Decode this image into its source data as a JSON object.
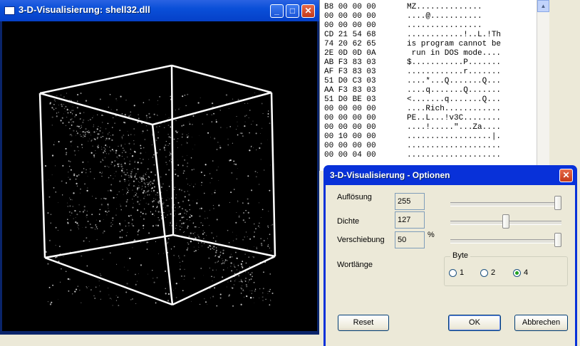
{
  "viz_window": {
    "title": "3-D-Visualisierung: shell32.dll",
    "buttons": [
      "_",
      "□",
      "✕"
    ]
  },
  "hex_view": {
    "hex_rows": [
      "B8 00 00 00",
      "00 00 00 00",
      "00 00 00 00",
      "CD 21 54 68",
      "74 20 62 65",
      "2E 0D 0D 0A",
      "AB F3 83 03",
      "AF F3 83 03",
      "51 D0 C3 03",
      "AA F3 83 03",
      "51 D0 BE 03",
      "00 00 00 00",
      "00 00 00 00",
      "00 00 00 00",
      "00 10 00 00",
      "00 00 00 00",
      "00 00 04 00"
    ],
    "ascii_rows": [
      "MZ..............",
      "....@...........",
      "................",
      "............!..L.!Th",
      "is program cannot be",
      " run in DOS mode....",
      "$...........P.......",
      "............r.......",
      "....*...Q.......Q...",
      "....q.......Q.......",
      "<.......q.......Q...",
      "....Rich............",
      "PE..L...!v3C........",
      "....!.....\"...Za....",
      "..................|.",
      "....................",
      "...................."
    ]
  },
  "options_dialog": {
    "title": "3-D-Visualisierung - Optionen",
    "close_label": "✕",
    "aufloesung": {
      "label": "Auflösung",
      "value": "255",
      "level": 1.0
    },
    "dichte": {
      "label": "Dichte",
      "value": "127",
      "level": 0.5
    },
    "verschiebung": {
      "label": "Verschiebung",
      "value": "50",
      "unit": "%",
      "level": 1.0
    },
    "wortlaenge": {
      "label": "Wortlänge",
      "group_title": "Byte",
      "options": [
        "1",
        "2",
        "4"
      ],
      "selected": "4"
    },
    "buttons": {
      "reset": "Reset",
      "ok": "OK",
      "cancel": "Abbrechen"
    }
  }
}
